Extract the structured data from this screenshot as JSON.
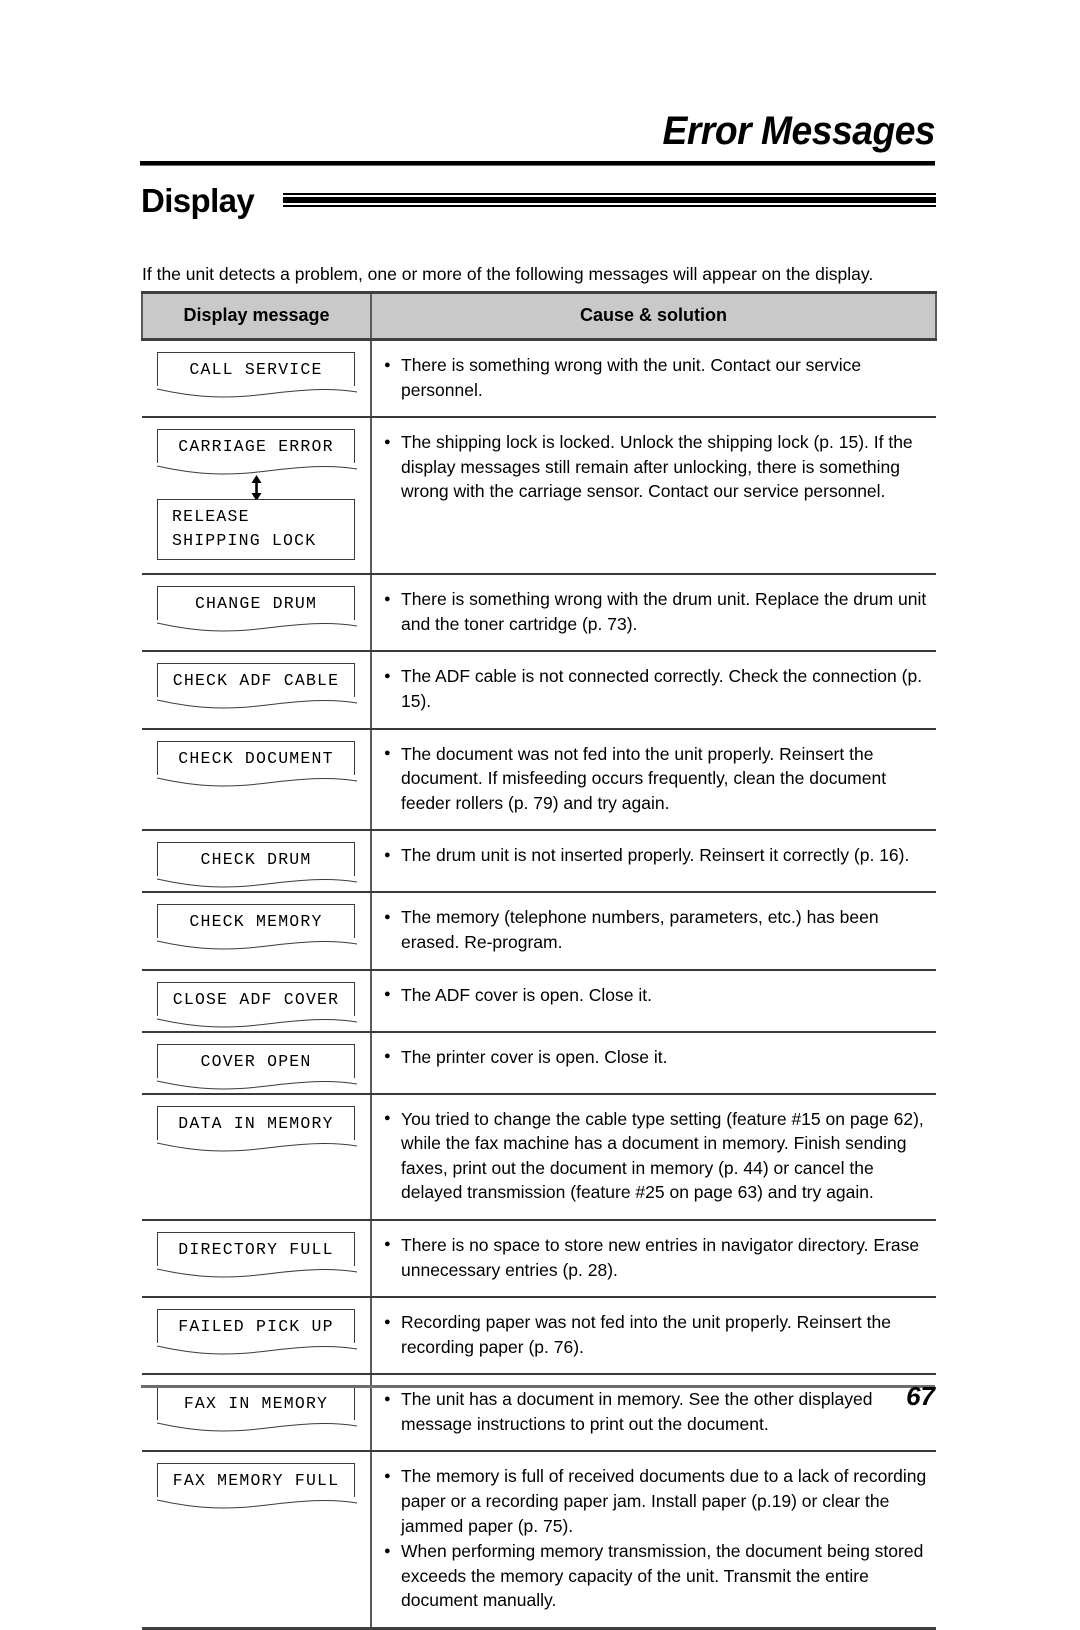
{
  "chapter": {
    "title": "Error Messages"
  },
  "section": {
    "title": "Display",
    "intro": "If the unit detects a problem, one or more of the following messages will appear on the display."
  },
  "table": {
    "headers": {
      "message": "Display message",
      "cause": "Cause & solution"
    },
    "rows": [
      {
        "display": [
          "CALL SERVICE"
        ],
        "display_second": null,
        "arrow": null,
        "solutions": [
          "There is something wrong with the unit. Contact our service personnel."
        ]
      },
      {
        "display": [
          "CARRIAGE ERROR"
        ],
        "display_second": [
          "RELEASE",
          "SHIPPING LOCK"
        ],
        "arrow": "up-down-arrow-icon",
        "solutions": [
          "The shipping lock is locked. Unlock the shipping lock (p. 15). If the display messages still remain after unlocking, there is something wrong with the carriage sensor. Contact our service personnel."
        ]
      },
      {
        "display": [
          "CHANGE DRUM"
        ],
        "display_second": null,
        "arrow": null,
        "solutions": [
          "There is something wrong with the drum unit. Replace the drum unit and the toner cartridge (p. 73)."
        ]
      },
      {
        "display": [
          "CHECK ADF CABLE"
        ],
        "display_second": null,
        "arrow": null,
        "solutions": [
          "The ADF cable is not connected correctly. Check the connection (p. 15)."
        ]
      },
      {
        "display": [
          "CHECK DOCUMENT"
        ],
        "display_second": null,
        "arrow": null,
        "solutions": [
          "The document was not fed into the unit properly. Reinsert the document. If misfeeding occurs frequently, clean the document feeder rollers (p. 79) and try again."
        ]
      },
      {
        "display": [
          "CHECK DRUM"
        ],
        "display_second": null,
        "arrow": null,
        "solutions": [
          "The drum unit is not inserted properly. Reinsert it correctly (p. 16)."
        ]
      },
      {
        "display": [
          "CHECK MEMORY"
        ],
        "display_second": null,
        "arrow": null,
        "solutions": [
          "The memory (telephone numbers, parameters, etc.) has been erased. Re-program."
        ]
      },
      {
        "display": [
          "CLOSE ADF COVER"
        ],
        "display_second": null,
        "arrow": null,
        "solutions": [
          "The ADF cover is open. Close it."
        ]
      },
      {
        "display": [
          "COVER OPEN"
        ],
        "display_second": null,
        "arrow": null,
        "solutions": [
          "The printer cover is open. Close it."
        ]
      },
      {
        "display": [
          "DATA IN MEMORY"
        ],
        "display_second": null,
        "arrow": null,
        "solutions": [
          "You tried to change the cable type setting (feature #15 on page 62), while the fax machine has a document in memory. Finish sending faxes, print out the document in memory (p. 44) or cancel the delayed transmission (feature #25 on page 63) and try again."
        ]
      },
      {
        "display": [
          "DIRECTORY FULL"
        ],
        "display_second": null,
        "arrow": null,
        "solutions": [
          "There is no space to store new entries in navigator directory. Erase unnecessary entries (p. 28)."
        ]
      },
      {
        "display": [
          "FAILED PICK UP"
        ],
        "display_second": null,
        "arrow": null,
        "solutions": [
          "Recording paper was not fed into the unit properly. Reinsert the recording paper (p. 76)."
        ]
      },
      {
        "display": [
          "FAX IN MEMORY"
        ],
        "display_second": null,
        "arrow": null,
        "solutions": [
          "The unit has a document in memory. See the other displayed message instructions to print out the document."
        ]
      },
      {
        "display": [
          "FAX MEMORY FULL"
        ],
        "display_second": null,
        "arrow": null,
        "solutions": [
          "The memory is full of received documents due to a lack of recording paper or a recording paper jam. Install paper (p.19) or clear the jammed paper (p. 75).",
          "When performing memory transmission, the document being stored exceeds the memory capacity of the unit. Transmit the entire document manually."
        ]
      }
    ]
  },
  "footer": {
    "page_number": "67"
  },
  "colors": {
    "header_fill": "#c9c9c9",
    "rule": "#3f3f3f",
    "text": "#000000"
  }
}
